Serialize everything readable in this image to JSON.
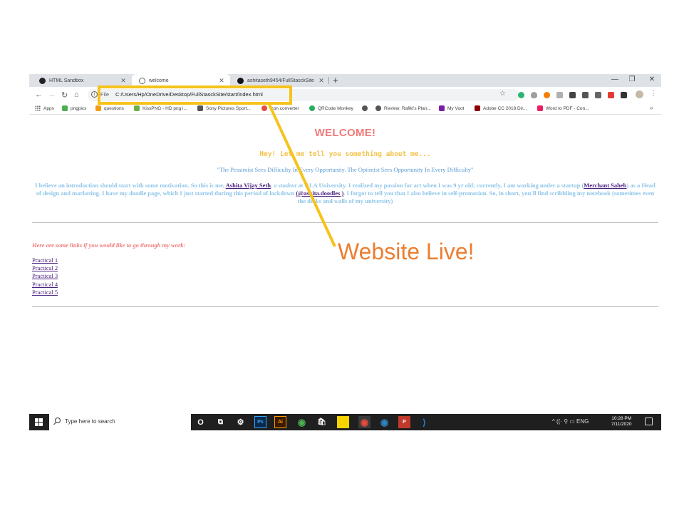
{
  "browser": {
    "tabs": [
      {
        "title": "HTML Sandbox",
        "active": false,
        "icon": "codepen-icon"
      },
      {
        "title": "welcome",
        "active": true,
        "icon": "globe-icon"
      },
      {
        "title": "ashitaseth9454/FullStasckSite",
        "active": false,
        "icon": "github-icon"
      }
    ],
    "new_tab": "+",
    "controls": {
      "minimize": "—",
      "maximize": "❐",
      "close": "✕"
    },
    "nav": {
      "back": "←",
      "forward": "→",
      "reload": "↻",
      "home": "⌂"
    },
    "omnibox": {
      "info": "i",
      "scheme_label": "File",
      "url": "C:/Users/Hp/OneDrive/Desktop/FullStasckSite/start/index.html"
    },
    "star": "☆",
    "menu": "⋮",
    "bookmarks": [
      {
        "label": "Apps",
        "icon": "apps-grid-icon",
        "color": "#5f6368"
      },
      {
        "label": "pngpics",
        "icon": "pngpics-icon",
        "color": "#4caf50"
      },
      {
        "label": "questions",
        "icon": "questions-icon",
        "color": "#f39c12"
      },
      {
        "label": "KissPNG - HD png i...",
        "icon": "kisspng-icon",
        "color": "#6ab04c"
      },
      {
        "label": "Sony Pictures Sport...",
        "icon": "sony-icon",
        "color": "#555555"
      },
      {
        "label": "icon converter",
        "icon": "converter-icon",
        "color": "#e74c3c"
      },
      {
        "label": "QRCode Monkey",
        "icon": "qrcode-icon",
        "color": "#27ae60"
      },
      {
        "label": "",
        "icon": "globe-icon",
        "color": "#555555"
      },
      {
        "label": "Review: Rafiki's Plan...",
        "icon": "globe-icon",
        "color": "#555555"
      },
      {
        "label": "My Voot",
        "icon": "voot-icon",
        "color": "#7b1fa2"
      },
      {
        "label": "Adobe CC 2018 Dir...",
        "icon": "adobe-icon",
        "color": "#8b0000"
      },
      {
        "label": "Word to PDF - Con...",
        "icon": "word-pdf-icon",
        "color": "#e91e63"
      }
    ],
    "bookmarks_more": "»"
  },
  "page": {
    "title": "WELCOME!",
    "subtitle": "Hey! Let me tell you something about me...",
    "quote": "\"The Pessimist Sees Difficulty In Every Opportunity. The Optimist Sees Opportunity In Every Difficulty\"",
    "intro": {
      "p1": "I believe an introduction should start with some motivation. So this is me, ",
      "name": "Ashita Vijay Seth",
      "p2": ", ",
      "student": "a student",
      "p3": " at GLA University. I realized my passion for art when I was 9 yr old; currently, I am working under a startup (",
      "startup": "Merchant Saheb",
      "p4": ") as a Head of design and marketing. I have my doodle page, which I just started during this period of lockdown ",
      "handle": "(@ashita.doodles )",
      "p5": ". I forgot to tell you that I also believe in self-promotion. So, in short, you'll find scribbling my notebook (sometimes even the desks and walls of my university)"
    },
    "links_heading": "Here are some links if you would like to go through my work:",
    "links": [
      "Practical 1",
      "Practical 2",
      "Practical 3",
      "Practical 4",
      "Practical 5"
    ]
  },
  "taskbar": {
    "search_placeholder": "Type here to search",
    "apps": [
      {
        "name": "cortana",
        "label": "O",
        "color": "transparent"
      },
      {
        "name": "task-view",
        "label": "⧉",
        "color": "transparent"
      },
      {
        "name": "settings",
        "label": "⚙",
        "color": "transparent"
      },
      {
        "name": "photoshop",
        "label": "Ps",
        "color": "#0b2a4a"
      },
      {
        "name": "illustrator",
        "label": "Ai",
        "color": "#3a1a00"
      },
      {
        "name": "chrome",
        "label": "◉",
        "color": "#2e7d32"
      },
      {
        "name": "store",
        "label": "🛍",
        "color": "transparent"
      },
      {
        "name": "sticky-notes",
        "label": "",
        "color": "#f6d200"
      },
      {
        "name": "chrome-profile-1",
        "label": "◉",
        "color": "#c0392b"
      },
      {
        "name": "chrome-profile-2",
        "label": "◉",
        "color": "#2e86c1"
      },
      {
        "name": "powerpoint",
        "label": "P",
        "color": "#c0392b"
      },
      {
        "name": "vscode",
        "label": "⟩",
        "color": "#1e88e5"
      }
    ],
    "tray_text": "^ ((· ⚲ ▭ ENG",
    "time": "10:28 PM",
    "date": "7/11/2020"
  },
  "annotation": {
    "label": "Website Live!",
    "highlight_color": "#f6c31c",
    "text_color": "#ed7d31"
  }
}
